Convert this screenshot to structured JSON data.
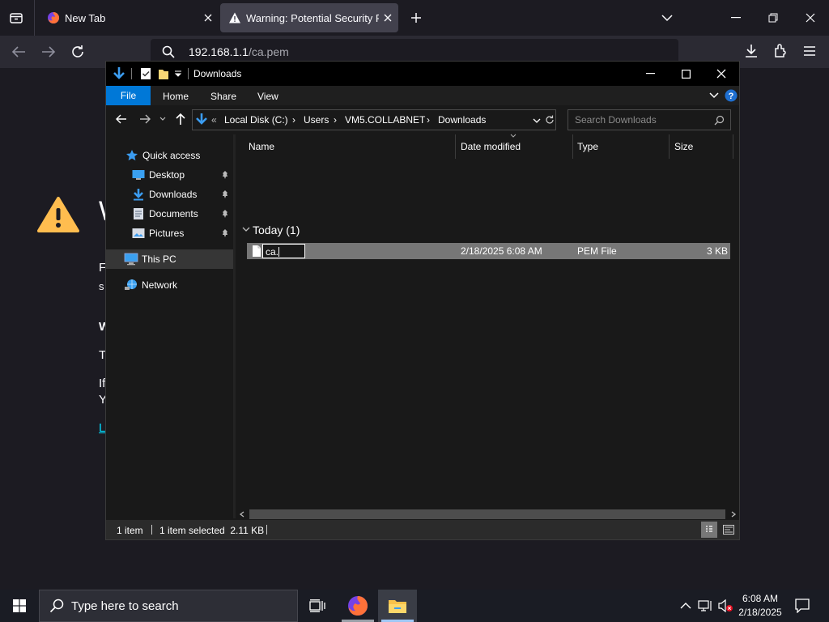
{
  "firefox": {
    "tabs": [
      {
        "title": "New Tab",
        "active": false
      },
      {
        "title": "Warning: Potential Security Risk",
        "active": true
      }
    ],
    "url": {
      "host": "192.168.1.1",
      "path": "/ca.pem"
    },
    "page": {
      "heading_initial": "W",
      "lines": [
        "F",
        "s",
        "W",
        "T",
        "If",
        "Y",
        "L"
      ]
    }
  },
  "explorer": {
    "title": "Downloads",
    "ribbon_tabs": [
      "File",
      "Home",
      "Share",
      "View"
    ],
    "address": {
      "overflow": "«",
      "crumbs": [
        "Local Disk (C:)",
        "Users",
        "VM5.COLLABNET",
        "Downloads"
      ]
    },
    "search_placeholder": "Search Downloads",
    "nav": {
      "quick_access": "Quick access",
      "pinned": [
        "Desktop",
        "Downloads",
        "Documents",
        "Pictures"
      ],
      "this_pc": "This PC",
      "network": "Network"
    },
    "columns": [
      "Name",
      "Date modified",
      "Type",
      "Size"
    ],
    "group_header": "Today (1)",
    "files": [
      {
        "name_editing": "ca.",
        "date": "2/18/2025 6:08 AM",
        "type": "PEM File",
        "size": "3 KB"
      }
    ],
    "status": {
      "count": "1 item",
      "selection": "1 item selected  2.11 KB"
    }
  },
  "taskbar": {
    "search_placeholder": "Type here to search",
    "time": "6:08 AM",
    "date": "2/18/2025"
  },
  "colors": {
    "accent_blue": "#0078d7",
    "warning_yellow": "#ffbd4f",
    "selected_row": "#777777"
  }
}
